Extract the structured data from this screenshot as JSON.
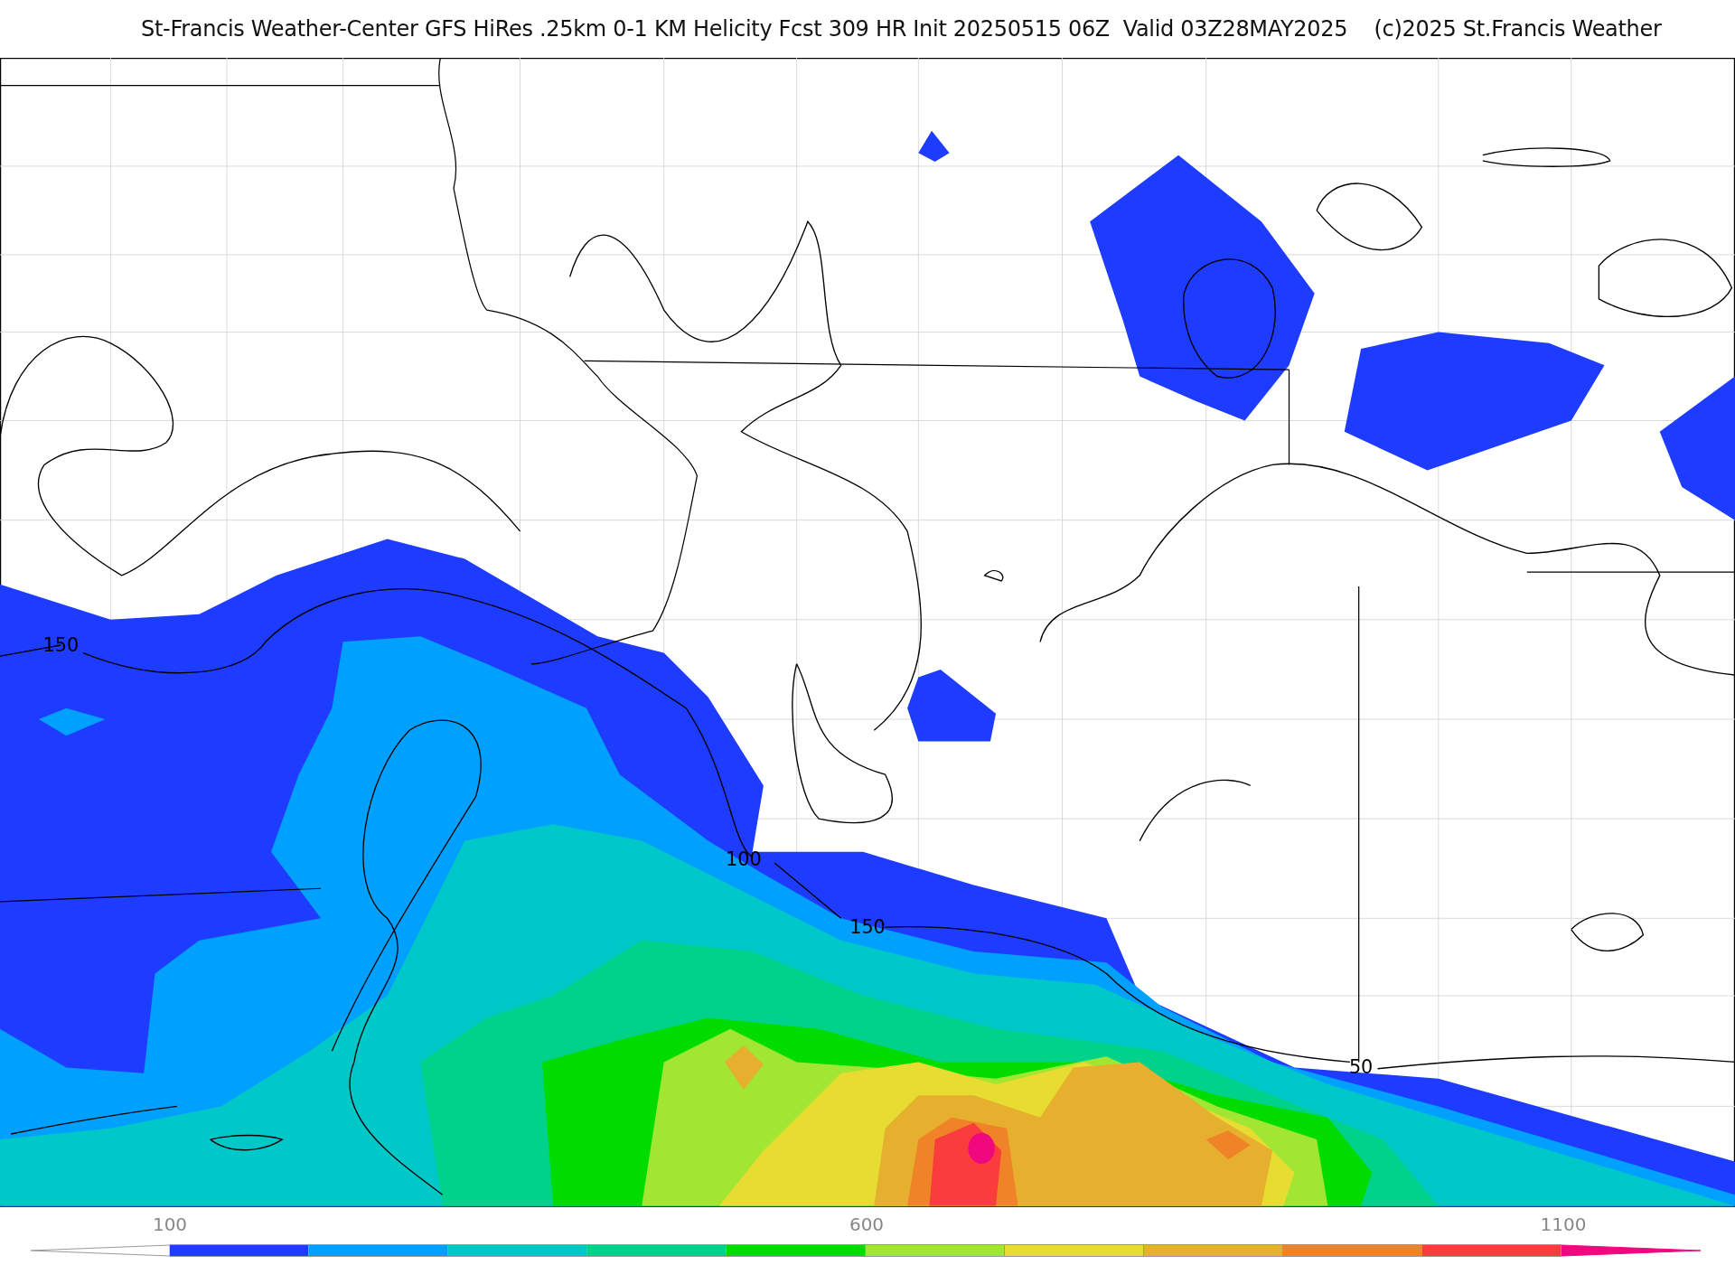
{
  "title": "St-Francis Weather-Center GFS HiRes .25km 0-1 KM Helicity Fcst 309 HR Init 20250515 06Z  Valid 03Z28MAY2025    (c)2025 St.Francis Weather",
  "map": {
    "contour_labels": [
      "150",
      "100",
      "150",
      "50"
    ]
  },
  "colorbar": {
    "labels": [
      "100",
      "600",
      "1100"
    ],
    "ends": [
      {
        "kind": "under"
      },
      {
        "kind": "over",
        "color": "#f0087f"
      }
    ],
    "segments": [
      {
        "color": "#1e3cff"
      },
      {
        "color": "#00a0ff"
      },
      {
        "color": "#00c8c8"
      },
      {
        "color": "#00d28c"
      },
      {
        "color": "#00dc00"
      },
      {
        "color": "#a0e632"
      },
      {
        "color": "#e6dc32"
      },
      {
        "color": "#e6af2d"
      },
      {
        "color": "#f08228"
      },
      {
        "color": "#fa3c3c"
      }
    ]
  }
}
